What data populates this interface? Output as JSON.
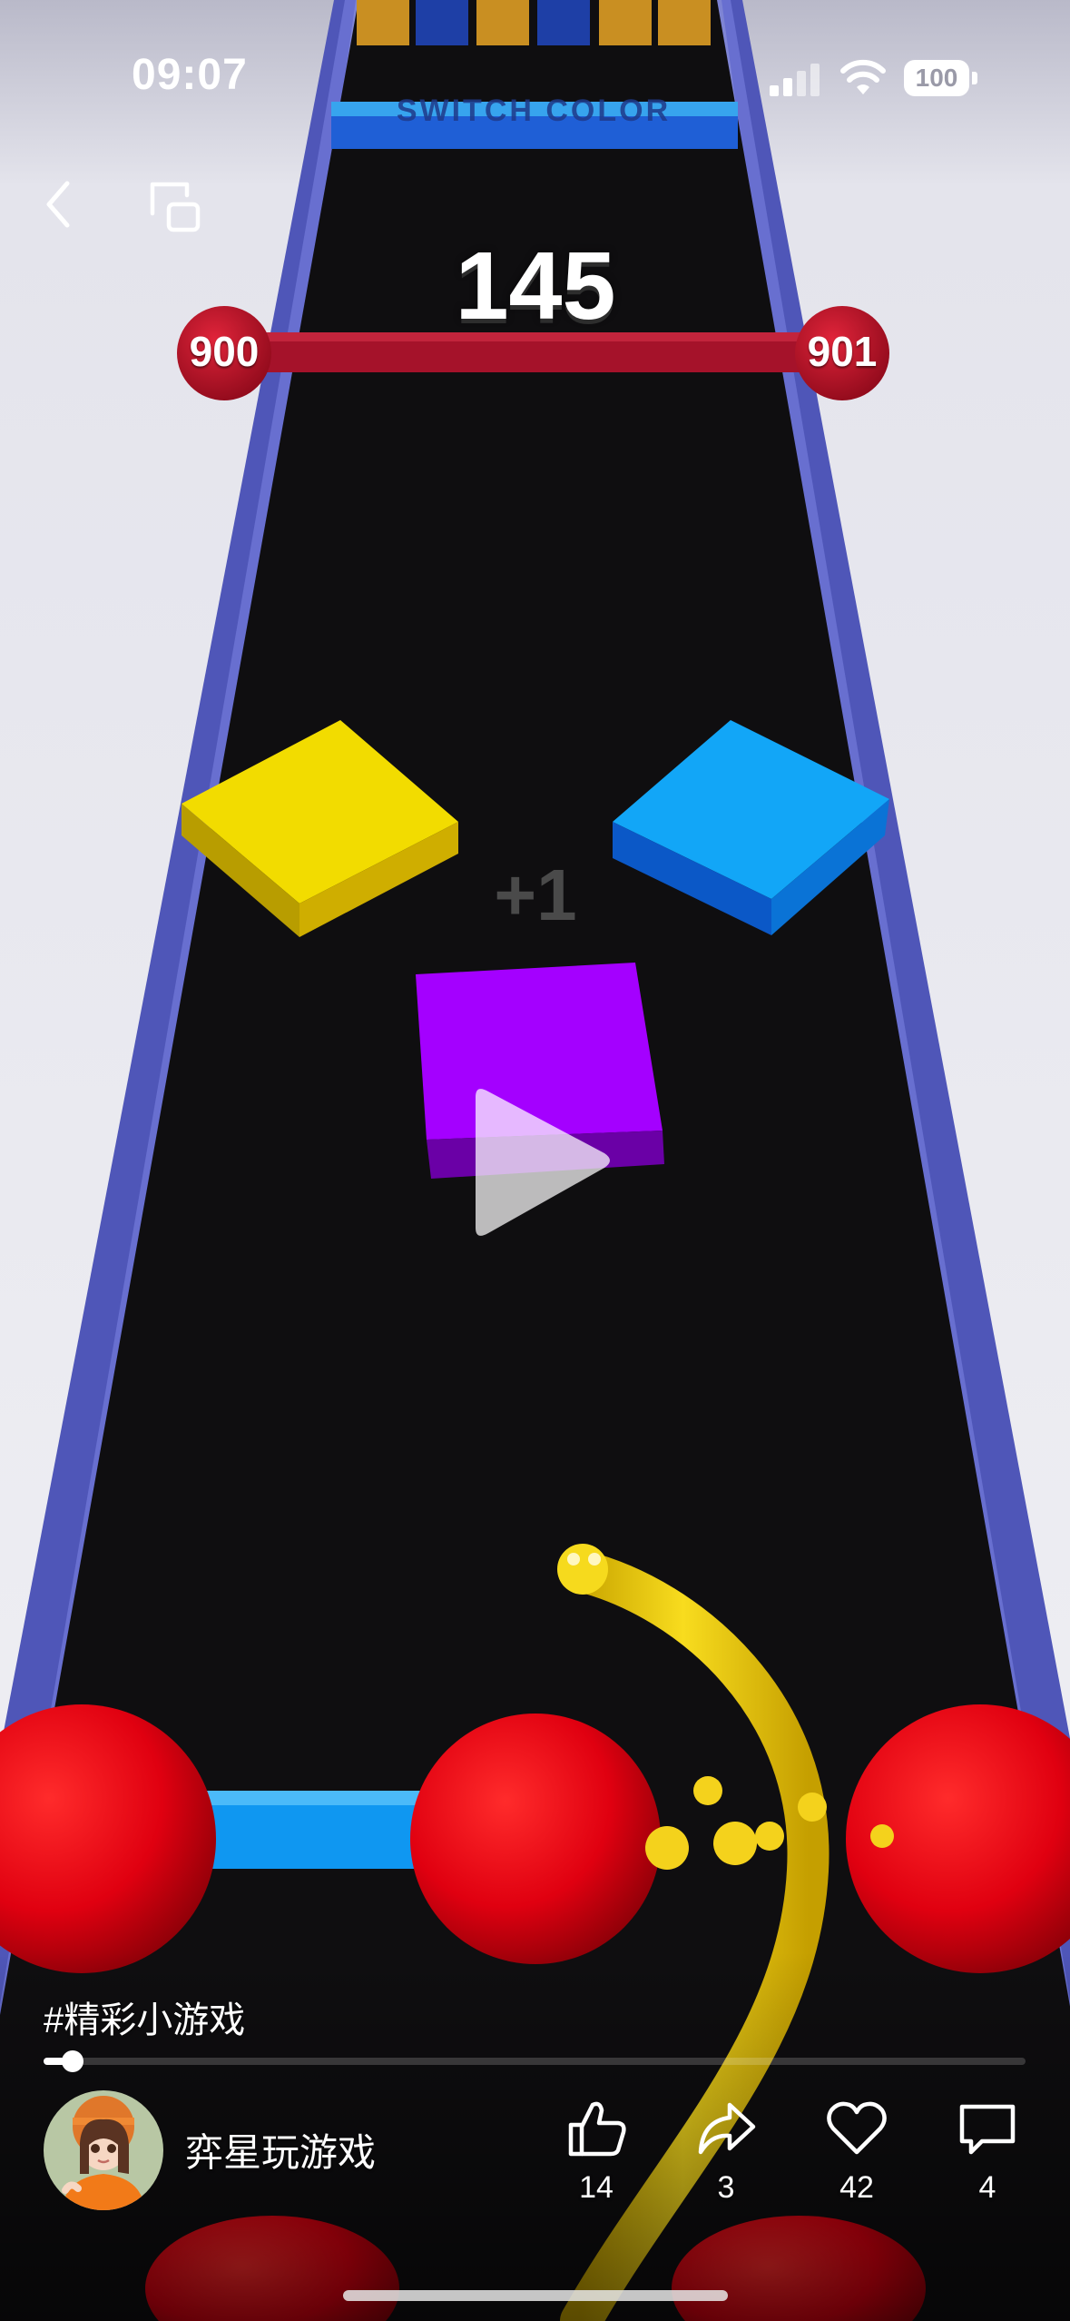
{
  "status_bar": {
    "time": "09:07",
    "battery": "100",
    "signal_icon": "cellular-signal-icon",
    "wifi_icon": "wifi-icon"
  },
  "nav": {
    "back_icon": "chevron-left-icon",
    "pip_icon": "picture-in-picture-icon"
  },
  "game": {
    "banner_text": "SWITCH COLOR",
    "score": "145",
    "progress": {
      "current_level": "900",
      "next_level": "901"
    },
    "popup_text": "+1",
    "colors": {
      "track": "#0f0e10",
      "rail": "#5c64c7",
      "yellow_block": "#f2dc00",
      "blue_block": "#10a0f5",
      "purple_block": "#a400ff",
      "red_sphere": "#e8000e",
      "snake": "#f4d21c"
    }
  },
  "video": {
    "play_icon": "play-icon",
    "caption": "#精彩小游戏",
    "progress_fraction": 0.03
  },
  "author": {
    "name": "弈星玩游戏",
    "avatar_icon": "avatar"
  },
  "actions": {
    "like": {
      "icon": "thumbs-up-icon",
      "count": "14"
    },
    "share": {
      "icon": "share-arrow-icon",
      "count": "3"
    },
    "favorite": {
      "icon": "heart-icon",
      "count": "42"
    },
    "comment": {
      "icon": "comment-icon",
      "count": "4"
    }
  }
}
